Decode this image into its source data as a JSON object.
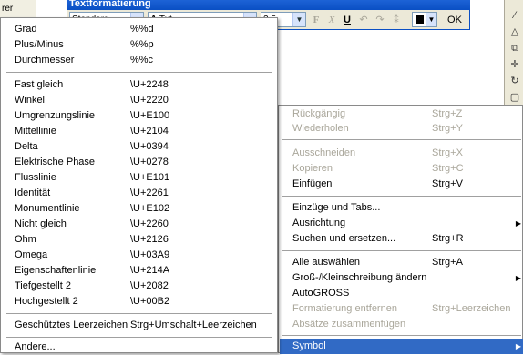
{
  "topleft": {
    "label": "rer"
  },
  "toolbar": {
    "title": "Textformatierung",
    "style_value": "Standard",
    "font_value": "Txt",
    "height_value": "2.5",
    "bold_label": "F",
    "italic_label": "X",
    "underline_label": "U",
    "ok_label": "OK",
    "color_value": "#000000"
  },
  "symbol_menu": {
    "items": [
      {
        "name": "Grad",
        "code": "%%d"
      },
      {
        "name": "Plus/Minus",
        "code": "%%p"
      },
      {
        "name": "Durchmesser",
        "code": "%%c"
      },
      {
        "name": "Fast gleich",
        "code": "\\U+2248"
      },
      {
        "name": "Winkel",
        "code": "\\U+2220"
      },
      {
        "name": "Umgrenzungslinie",
        "code": "\\U+E100"
      },
      {
        "name": "Mittellinie",
        "code": "\\U+2104"
      },
      {
        "name": "Delta",
        "code": "\\U+0394"
      },
      {
        "name": "Elektrische Phase",
        "code": "\\U+0278"
      },
      {
        "name": "Flusslinie",
        "code": "\\U+E101"
      },
      {
        "name": "Identität",
        "code": "\\U+2261"
      },
      {
        "name": "Monumentlinie",
        "code": "\\U+E102"
      },
      {
        "name": "Nicht gleich",
        "code": "\\U+2260"
      },
      {
        "name": "Ohm",
        "code": "\\U+2126"
      },
      {
        "name": "Omega",
        "code": "\\U+03A9"
      },
      {
        "name": "Eigenschaftenlinie",
        "code": "\\U+214A"
      },
      {
        "name": "Tiefgestellt 2",
        "code": "\\U+2082"
      },
      {
        "name": "Hochgestellt 2",
        "code": "\\U+00B2"
      },
      {
        "name": "Geschütztes Leerzeichen",
        "code": "Strg+Umschalt+Leerzeichen"
      },
      {
        "name": "Andere...",
        "code": ""
      }
    ]
  },
  "context_menu": {
    "items": [
      {
        "name": "Rückgängig",
        "key": "Strg+Z",
        "disabled": true
      },
      {
        "name": "Wiederholen",
        "key": "Strg+Y",
        "disabled": true
      },
      {
        "name": "Ausschneiden",
        "key": "Strg+X",
        "disabled": true
      },
      {
        "name": "Kopieren",
        "key": "Strg+C",
        "disabled": true
      },
      {
        "name": "Einfügen",
        "key": "Strg+V",
        "disabled": false
      },
      {
        "name": "Einzüge und Tabs...",
        "key": "",
        "disabled": false
      },
      {
        "name": "Ausrichtung",
        "key": "",
        "disabled": false
      },
      {
        "name": "Suchen und ersetzen...",
        "key": "Strg+R",
        "disabled": false
      },
      {
        "name": "Alle auswählen",
        "key": "Strg+A",
        "disabled": false
      },
      {
        "name": "Groß-/Kleinschreibung ändern",
        "key": "",
        "disabled": false
      },
      {
        "name": "AutoGROSS",
        "key": "",
        "disabled": false
      },
      {
        "name": "Formatierung entfernen",
        "key": "Strg+Leerzeichen",
        "disabled": true
      },
      {
        "name": "Absätze zusammenfügen",
        "key": "",
        "disabled": true
      },
      {
        "name": "Symbol",
        "key": "",
        "disabled": false,
        "highlighted": true
      }
    ]
  },
  "colors": {
    "highlight": "#316ac5",
    "titlebar": "#0a4fc4",
    "disabled_text": "#a9a69a"
  }
}
